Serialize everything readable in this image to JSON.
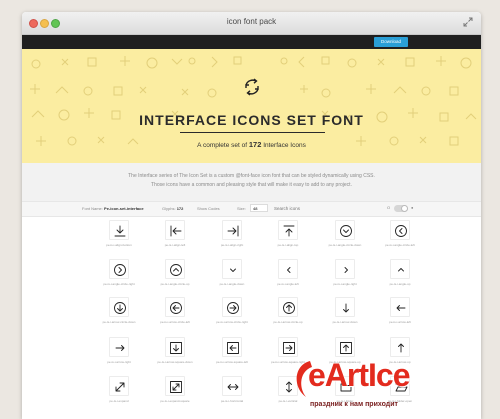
{
  "window": {
    "title": "icon font pack"
  },
  "topbar": {
    "download_label": "Download"
  },
  "hero": {
    "title": "INTERFACE ICONS SET FONT",
    "subtitle_prefix": "A complete set of",
    "count": "172",
    "subtitle_suffix": "Interface Icons"
  },
  "intro": {
    "line1": "The Interface series of The Icon Set is a custom @font-face icon font that can be styled dynamically using CSS.",
    "line2": "Those icons have a common and pleasing style that will make it easy to add to any project."
  },
  "toolbar": {
    "font_name_label": "Font Name:",
    "font_name": "Pe-icon-set-interface",
    "glyphs_label": "Glyphs:",
    "glyphs": "172",
    "show_codes": "Show Codes",
    "size_label": "Size:",
    "size_value": "48",
    "search_placeholder": "Search icons",
    "toggle_off": "O",
    "toggle_on": "●"
  },
  "icons": [
    {
      "name": "pe-is-i-align-bottom",
      "glyph": "align-bottom"
    },
    {
      "name": "pe-is-i-align-left",
      "glyph": "align-left"
    },
    {
      "name": "pe-is-i-align-right",
      "glyph": "align-right"
    },
    {
      "name": "pe-is-i-align-top",
      "glyph": "align-top"
    },
    {
      "name": "pe-is-i-angle-circle-down",
      "glyph": "circle-chevron-down"
    },
    {
      "name": "pe-is-i-angle-circle-left",
      "glyph": "circle-chevron-left"
    },
    {
      "name": "pe-is-i-angle-circle-right",
      "glyph": "circle-chevron-right"
    },
    {
      "name": "pe-is-i-angle-circle-up",
      "glyph": "circle-chevron-up"
    },
    {
      "name": "pe-is-i-angle-down",
      "glyph": "chevron-down"
    },
    {
      "name": "pe-is-i-angle-left",
      "glyph": "chevron-left"
    },
    {
      "name": "pe-is-i-angle-right",
      "glyph": "chevron-right"
    },
    {
      "name": "pe-is-i-angle-up",
      "glyph": "chevron-up"
    },
    {
      "name": "pe-is-i-arrow-circle-down",
      "glyph": "circle-arrow-down"
    },
    {
      "name": "pe-is-i-arrow-circle-left",
      "glyph": "circle-arrow-left"
    },
    {
      "name": "pe-is-i-arrow-circle-right",
      "glyph": "circle-arrow-right"
    },
    {
      "name": "pe-is-i-arrow-circle-up",
      "glyph": "circle-arrow-up"
    },
    {
      "name": "pe-is-i-arrow-down",
      "glyph": "arrow-down"
    },
    {
      "name": "pe-is-i-arrow-left",
      "glyph": "arrow-left"
    },
    {
      "name": "pe-is-i-arrow-right",
      "glyph": "arrow-right"
    },
    {
      "name": "pe-is-i-arrow-square-down",
      "glyph": "square-arrow-down"
    },
    {
      "name": "pe-is-i-arrow-square-left",
      "glyph": "square-arrow-left"
    },
    {
      "name": "pe-is-i-arrow-square-right",
      "glyph": "square-arrow-right"
    },
    {
      "name": "pe-is-i-arrow-square-up",
      "glyph": "square-arrow-up"
    },
    {
      "name": "pe-is-i-arrow-up",
      "glyph": "arrow-up"
    },
    {
      "name": "pe-is-i-expand",
      "glyph": "diagonal-expand"
    },
    {
      "name": "pe-is-i-expand-square",
      "glyph": "diagonal-expand-square"
    },
    {
      "name": "pe-is-i-horizontal",
      "glyph": "arrow-horizontal"
    },
    {
      "name": "pe-is-i-vertical",
      "glyph": "arrow-vertical"
    },
    {
      "name": "pe-is-i-folder",
      "glyph": "folder"
    },
    {
      "name": "pe-is-i-folder-open",
      "glyph": "folder-open"
    }
  ],
  "watermark": {
    "brand": "eArtIce",
    "tagline": "праздник к нам приходит"
  }
}
